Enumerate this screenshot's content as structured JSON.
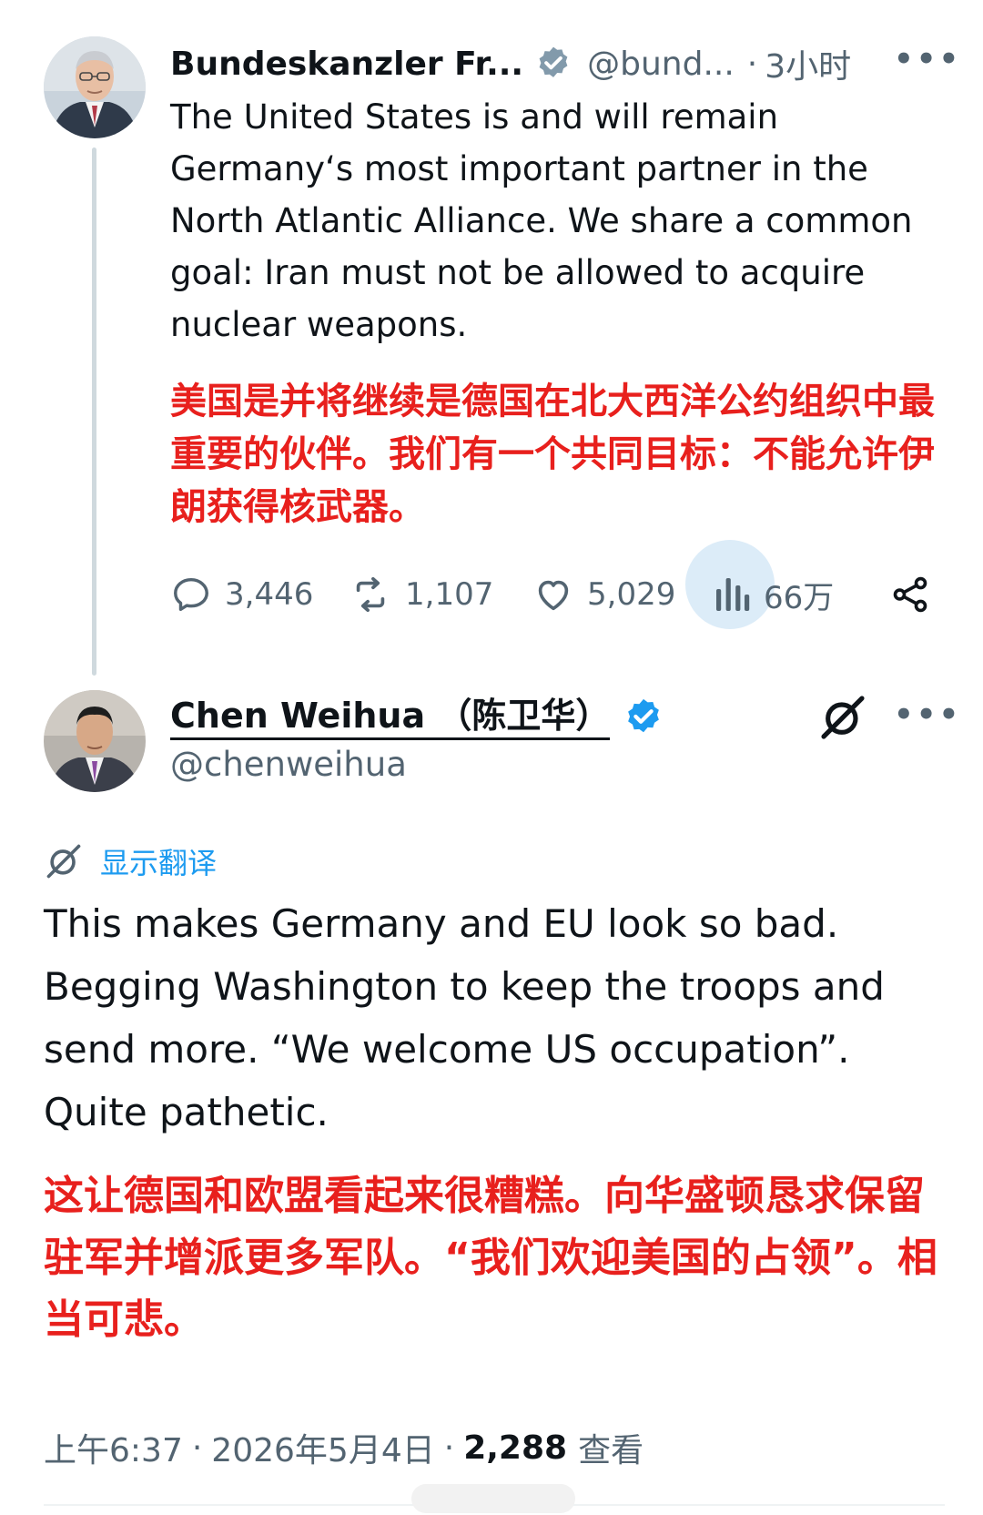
{
  "tweet1": {
    "display_name": "Bundeskanzler Fr...",
    "handle": "@bund...",
    "separator": "·",
    "time": "3小时",
    "text": "The United States is and will remain Germany‘s most important partner in the North Atlantic Alliance. We share a common goal: Iran must not be allowed to acquire nuclear weapons.",
    "translation": "美国是并将继续是德国在北大西洋公约组织中最重要的伙伴。我们有一个共同目标：不能允许伊朗获得核武器。",
    "stats": {
      "replies": "3,446",
      "reposts": "1,107",
      "likes": "5,029",
      "views": "66万"
    }
  },
  "tweet2": {
    "display_name": "Chen Weihua （陈卫华）",
    "handle": "@chenweihua",
    "show_translation": "显示翻译",
    "text": "This makes Germany and EU look so bad. Begging Washington to keep the troops and send more. “We welcome US occupation”. Quite pathetic.",
    "translation": "这让德国和欧盟看起来很糟糕。向华盛顿恳求保留驻军并增派更多军队。“我们欢迎美国的占领”。相当可悲。",
    "meta": {
      "time": "上午6:37",
      "sep": "·",
      "date": "2026年5月4日",
      "views": "2,288",
      "views_label": "查看"
    }
  },
  "colors": {
    "translation_red": "#e8201d",
    "link_blue": "#1d9bf0",
    "muted": "#536471",
    "verified_gray": "#829aab"
  }
}
